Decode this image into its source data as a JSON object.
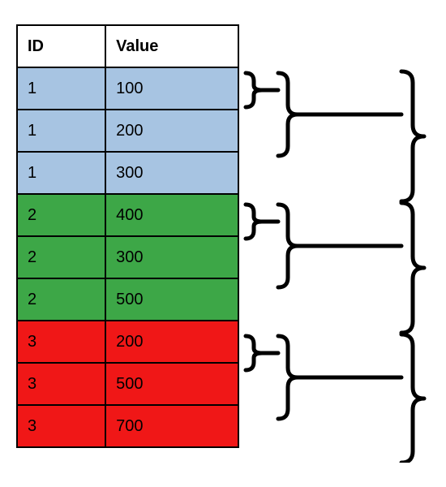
{
  "table": {
    "headers": {
      "id": "ID",
      "value": "Value"
    },
    "rows": [
      {
        "id": "1",
        "value": "100",
        "group": 1
      },
      {
        "id": "1",
        "value": "200",
        "group": 1
      },
      {
        "id": "1",
        "value": "300",
        "group": 1
      },
      {
        "id": "2",
        "value": "400",
        "group": 2
      },
      {
        "id": "2",
        "value": "300",
        "group": 2
      },
      {
        "id": "2",
        "value": "500",
        "group": 2
      },
      {
        "id": "3",
        "value": "200",
        "group": 3
      },
      {
        "id": "3",
        "value": "500",
        "group": 3
      },
      {
        "id": "3",
        "value": "700",
        "group": 3
      }
    ]
  },
  "colors": {
    "group1": "#a7c4e2",
    "group2": "#3da747",
    "group3": "#f01717"
  }
}
